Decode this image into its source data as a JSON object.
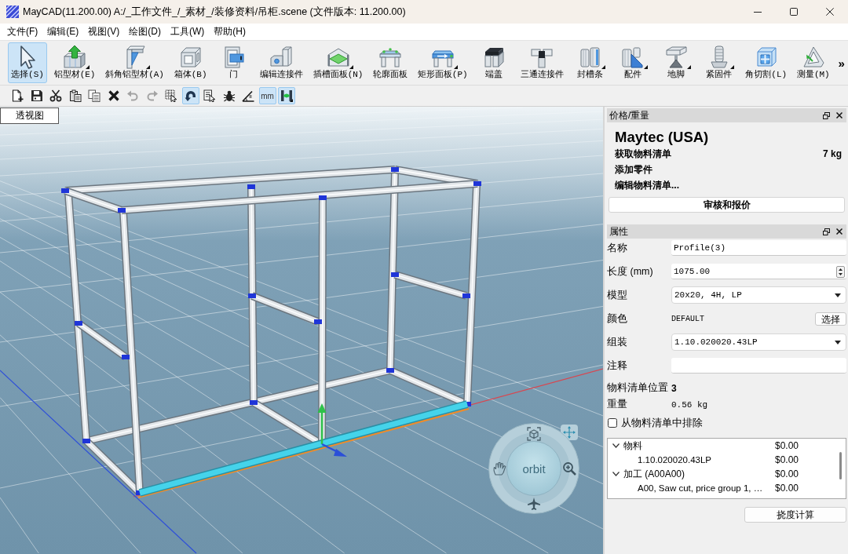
{
  "window": {
    "title": "MayCAD(11.200.00) A:/_工作文件_/_素材_/装修资料/吊柜.scene (文件版本: 11.200.00)"
  },
  "menu": [
    "文件(F)",
    "编辑(E)",
    "视图(V)",
    "绘图(D)",
    "工具(W)",
    "帮助(H)"
  ],
  "toolbar": {
    "tools": [
      {
        "label": "选择(S)",
        "selected": true,
        "has_menu": false
      },
      {
        "label": "铝型材(E)",
        "selected": false,
        "has_menu": true
      },
      {
        "label": "斜角铝型材(A)",
        "selected": false,
        "has_menu": true
      },
      {
        "label": "箱体(B)",
        "selected": false,
        "has_menu": false
      },
      {
        "label": "门",
        "selected": false,
        "has_menu": false
      },
      {
        "label": "编辑连接件",
        "selected": false,
        "has_menu": false
      },
      {
        "label": "插槽面板(N)",
        "selected": false,
        "has_menu": true
      },
      {
        "label": "轮廓面板",
        "selected": false,
        "has_menu": false
      },
      {
        "label": "矩形面板(P)",
        "selected": false,
        "has_menu": true
      },
      {
        "label": "端盖",
        "selected": false,
        "has_menu": false
      },
      {
        "label": "三通连接件",
        "selected": false,
        "has_menu": false
      },
      {
        "label": "封槽条",
        "selected": false,
        "has_menu": true
      },
      {
        "label": "配件",
        "selected": false,
        "has_menu": true
      },
      {
        "label": "地脚",
        "selected": false,
        "has_menu": true
      },
      {
        "label": "紧固件",
        "selected": false,
        "has_menu": true
      },
      {
        "label": "角切割(L)",
        "selected": false,
        "has_menu": false
      },
      {
        "label": "测量(M)",
        "selected": false,
        "has_menu": false
      }
    ],
    "overflow": "»"
  },
  "quick_toolbar": [
    {
      "on": false,
      "disabled": false
    },
    {
      "on": false,
      "disabled": false
    },
    {
      "on": false,
      "disabled": false
    },
    {
      "on": false,
      "disabled": false
    },
    {
      "on": false,
      "disabled": false
    },
    {
      "on": false,
      "disabled": false
    },
    {
      "on": false,
      "disabled": true
    },
    {
      "on": false,
      "disabled": true
    },
    {
      "on": false,
      "disabled": false
    },
    {
      "on": true,
      "disabled": false
    },
    {
      "on": false,
      "disabled": false
    },
    {
      "on": false,
      "disabled": false
    },
    {
      "on": false,
      "disabled": false
    },
    {
      "label": "mm",
      "on": true,
      "disabled": false
    },
    {
      "on": true,
      "disabled": false
    }
  ],
  "viewport": {
    "tab": "透视图",
    "navigation": {
      "center": "orbit"
    }
  },
  "price_panel": {
    "title": "价格/重量",
    "vendor": "Maytec (USA)",
    "actions": [
      {
        "label": "获取物料清单",
        "value": "7 kg"
      },
      {
        "label": "添加零件"
      },
      {
        "label": "编辑物料清单..."
      }
    ],
    "button": "审核和报价"
  },
  "properties_panel": {
    "title": "属性",
    "fields": [
      {
        "kind": "input",
        "label": "名称",
        "value": "Profile(3)"
      },
      {
        "kind": "spin",
        "label": "长度 (mm)",
        "value": "1075.00"
      },
      {
        "kind": "select",
        "label": "模型",
        "value": "20x20, 4H, LP"
      },
      {
        "kind": "color",
        "label": "颜色",
        "value": "DEFAULT",
        "button": "选择"
      },
      {
        "kind": "select",
        "label": "组装",
        "value": "1.10.020020.43LP"
      },
      {
        "kind": "input",
        "label": "注释"
      },
      {
        "kind": "number",
        "label": "物料清单位置",
        "value": "3"
      },
      {
        "kind": "text",
        "label": "重量",
        "value": "0.56 kg"
      }
    ],
    "exclude": {
      "label": "从物料清单中排除",
      "checked": false
    },
    "cost_tree": [
      {
        "label": "物料",
        "price": "$0.00",
        "expanded": true,
        "children": [
          {
            "label": "1.10.020020.43LP",
            "price": "$0.00"
          }
        ]
      },
      {
        "label": "加工 (A00A00)",
        "price": "$0.00",
        "expanded": true,
        "children": [
          {
            "label": "A00, Saw cut, price group 1, …",
            "price": "$0.00"
          }
        ]
      }
    ],
    "button": "挠度计算"
  }
}
